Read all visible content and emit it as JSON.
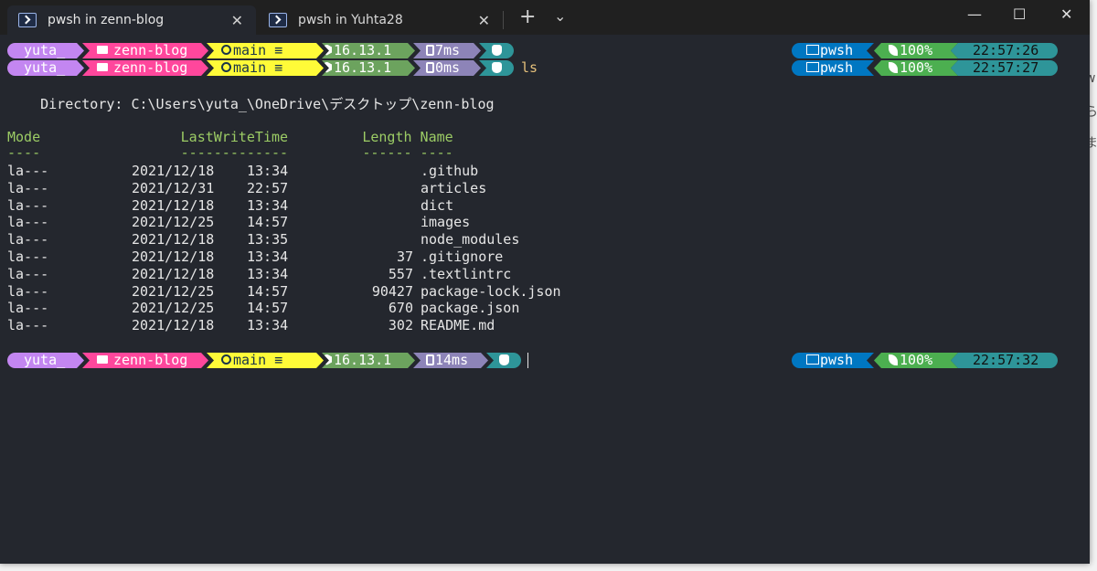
{
  "tabs": [
    {
      "title": "pwsh in zenn-blog",
      "active": true
    },
    {
      "title": "pwsh in Yuhta28",
      "active": false
    }
  ],
  "window_controls": {
    "minimize": "—",
    "maximize": "☐",
    "close": "✕"
  },
  "tab_controls": {
    "new_tab": "+",
    "dropdown": "⌄",
    "close": "✕"
  },
  "prompts": [
    {
      "user": "yuta_",
      "folder": "zenn-blog",
      "branch": "main ≡",
      "node": "16.13.1",
      "exec": "7ms",
      "command": "",
      "shell": "pwsh",
      "battery": "100%",
      "time": "22:57:26"
    },
    {
      "user": "yuta_",
      "folder": "zenn-blog",
      "branch": "main ≡",
      "node": "16.13.1",
      "exec": "0ms",
      "command": "ls",
      "shell": "pwsh",
      "battery": "100%",
      "time": "22:57:27"
    },
    {
      "user": "yuta_",
      "folder": "zenn-blog",
      "branch": "main ≡",
      "node": "16.13.1",
      "exec": "14ms",
      "command": "",
      "shell": "pwsh",
      "battery": "100%",
      "time": "22:57:32"
    }
  ],
  "listing": {
    "directory_line": "    Directory: C:\\Users\\yuta_\\OneDrive\\デスクトップ\\zenn-blog",
    "header": "Mode                 LastWriteTime         Length Name",
    "underline": "----                 -------------         ------ ----",
    "rows": [
      {
        "mode": "la---",
        "date": "2021/12/18",
        "time": "13:34",
        "length": "",
        "name": ".github"
      },
      {
        "mode": "la---",
        "date": "2021/12/31",
        "time": "22:57",
        "length": "",
        "name": "articles"
      },
      {
        "mode": "la---",
        "date": "2021/12/18",
        "time": "13:34",
        "length": "",
        "name": "dict"
      },
      {
        "mode": "la---",
        "date": "2021/12/25",
        "time": "14:57",
        "length": "",
        "name": "images"
      },
      {
        "mode": "la---",
        "date": "2021/12/18",
        "time": "13:35",
        "length": "",
        "name": "node_modules"
      },
      {
        "mode": "la---",
        "date": "2021/12/18",
        "time": "13:34",
        "length": "37",
        "name": ".gitignore"
      },
      {
        "mode": "la---",
        "date": "2021/12/18",
        "time": "13:34",
        "length": "557",
        "name": ".textlintrc"
      },
      {
        "mode": "la---",
        "date": "2021/12/25",
        "time": "14:57",
        "length": "90427",
        "name": "package-lock.json"
      },
      {
        "mode": "la---",
        "date": "2021/12/25",
        "time": "14:57",
        "length": "670",
        "name": "package.json"
      },
      {
        "mode": "la---",
        "date": "2021/12/18",
        "time": "13:34",
        "length": "302",
        "name": "README.md"
      }
    ]
  },
  "background_strip": [
    "w",
    "ら",
    "ま"
  ],
  "colors": {
    "terminal_bg": "#24272e",
    "tabbar_bg": "#202020",
    "user": "#c386f1",
    "folder": "#ff479c",
    "git": "#fffb38",
    "node": "#6ca35e",
    "exec": "#8d84b8",
    "status": "#2e9599",
    "shell": "#0077c2",
    "battery": "#4caf50"
  }
}
